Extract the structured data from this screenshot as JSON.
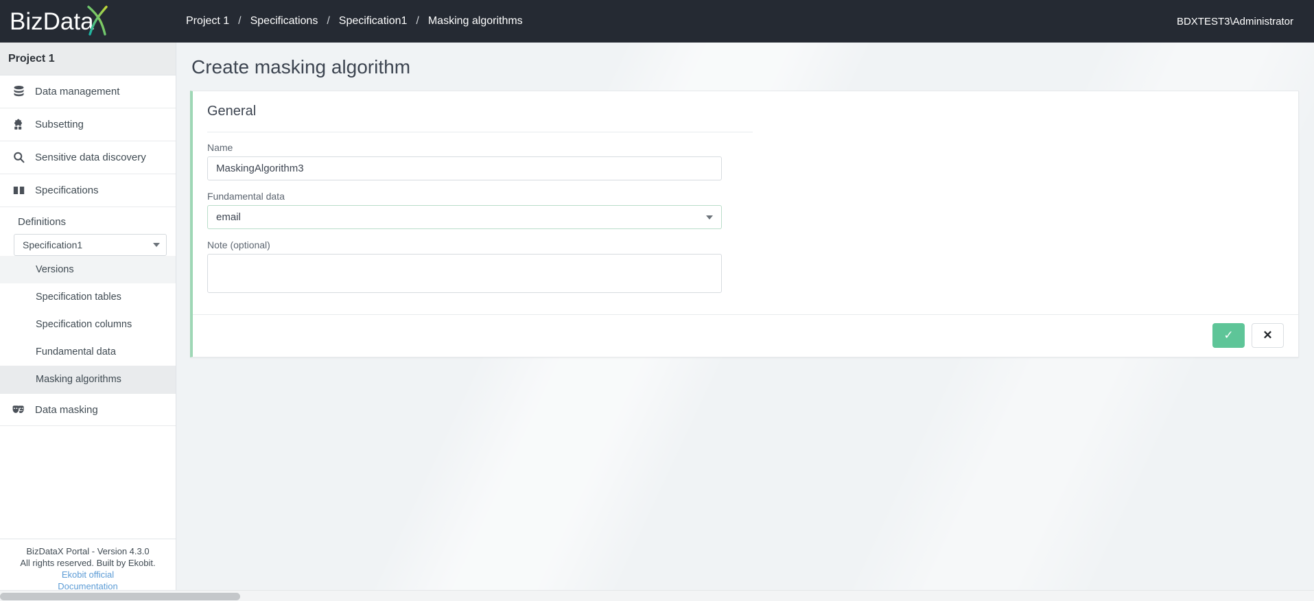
{
  "brand": {
    "name_text": "BizData",
    "logo_mark": "x-logo-icon",
    "gradient_from": "#19b3a6",
    "gradient_to": "#c3d936"
  },
  "header": {
    "breadcrumb": [
      {
        "label": "Project 1"
      },
      {
        "label": "Specifications"
      },
      {
        "label": "Specification1"
      },
      {
        "label": "Masking algorithms"
      }
    ],
    "separator": "/",
    "user": "BDXTEST3\\Administrator",
    "background": "#252a33"
  },
  "sidebar": {
    "project_title": "Project 1",
    "items": [
      {
        "label": "Data management",
        "icon": "database-icon"
      },
      {
        "label": "Subsetting",
        "icon": "puzzle-piece-icon"
      },
      {
        "label": "Sensitive data discovery",
        "icon": "search-icon"
      },
      {
        "label": "Specifications",
        "icon": "book-icon"
      }
    ],
    "definitions_label": "Definitions",
    "spec_selector": {
      "value": "Specification1",
      "caret": "chevron-down-icon"
    },
    "sub_items": [
      {
        "label": "Versions",
        "state": "shaded"
      },
      {
        "label": "Specification tables",
        "state": "normal"
      },
      {
        "label": "Specification columns",
        "state": "normal"
      },
      {
        "label": "Fundamental data",
        "state": "normal"
      },
      {
        "label": "Masking algorithms",
        "state": "active"
      }
    ],
    "data_masking": {
      "label": "Data masking",
      "icon": "theater-masks-icon"
    },
    "footer": {
      "line1": "BizDataX Portal - Version 4.3.0",
      "line2": "All rights reserved. Built by Ekobit.",
      "link1": "Ekobit official",
      "link2": "Documentation",
      "link_color": "#5b9bd5"
    }
  },
  "main": {
    "page_title": "Create masking algorithm",
    "card": {
      "accent_color": "#9ed7b5",
      "section_title": "General",
      "fields": {
        "name": {
          "label": "Name",
          "value": "MaskingAlgorithm3",
          "placeholder": ""
        },
        "fundamental_data": {
          "label": "Fundamental data",
          "value": "email",
          "caret": "chevron-down-icon"
        },
        "note": {
          "label": "Note (optional)",
          "value": "",
          "placeholder": ""
        }
      },
      "actions": {
        "confirm": {
          "glyph": "✓",
          "icon": "check-icon",
          "color": "#5ec598"
        },
        "cancel": {
          "glyph": "✕",
          "icon": "close-icon"
        }
      }
    }
  }
}
